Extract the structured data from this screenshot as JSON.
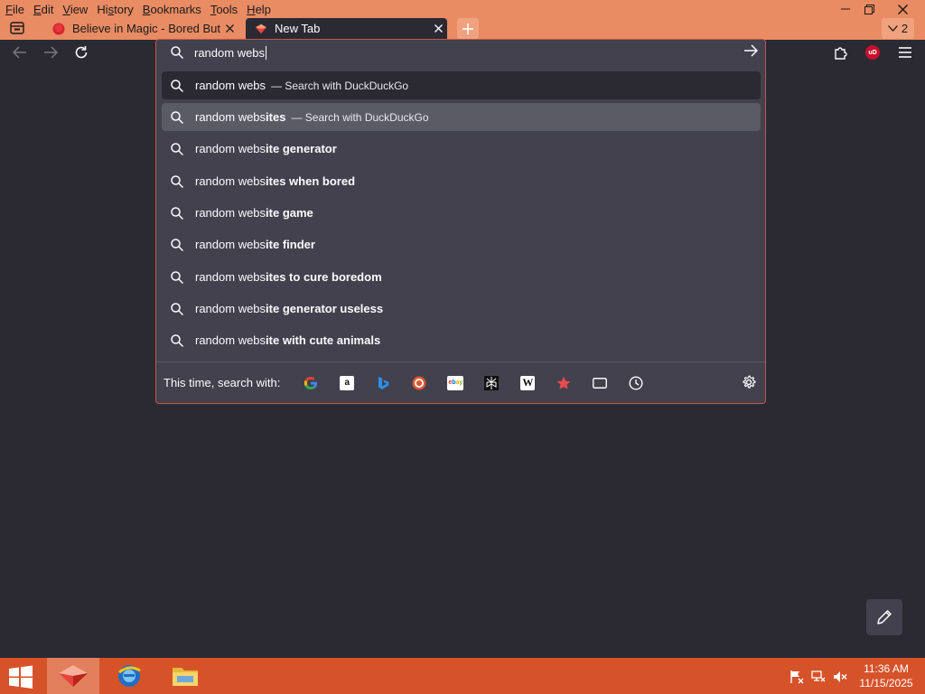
{
  "menu": {
    "items": [
      {
        "before": "",
        "key": "F",
        "after": "ile"
      },
      {
        "before": "",
        "key": "E",
        "after": "dit"
      },
      {
        "before": "",
        "key": "V",
        "after": "iew"
      },
      {
        "before": "Hi",
        "key": "s",
        "after": "tory"
      },
      {
        "before": "",
        "key": "B",
        "after": "ookmarks"
      },
      {
        "before": "",
        "key": "T",
        "after": "ools"
      },
      {
        "before": "",
        "key": "H",
        "after": "elp"
      }
    ]
  },
  "tabs": {
    "inactive_title": "Believe in Magic - Bored Button",
    "active_title": "New Tab",
    "all_tabs_count": "2"
  },
  "urlbar": {
    "value": "random webs"
  },
  "suggestions": [
    {
      "typed": "random webs",
      "bold": "",
      "action": "— Search with DuckDuckGo"
    },
    {
      "typed": "random webs",
      "bold": "ites",
      "action": "— Search with DuckDuckGo"
    },
    {
      "typed": "random webs",
      "bold": "ite generator",
      "action": ""
    },
    {
      "typed": "random webs",
      "bold": "ites when bored",
      "action": ""
    },
    {
      "typed": "random webs",
      "bold": "ite game",
      "action": ""
    },
    {
      "typed": "random webs",
      "bold": "ite finder",
      "action": ""
    },
    {
      "typed": "random webs",
      "bold": "ites to cure boredom",
      "action": ""
    },
    {
      "typed": "random webs",
      "bold": "ite generator useless",
      "action": ""
    },
    {
      "typed": "random webs",
      "bold": "ite with cute animals",
      "action": ""
    }
  ],
  "oneoff": {
    "label": "This time, search with:",
    "engines": [
      "google-icon",
      "amazon-icon",
      "bing-icon",
      "duckduckgo-icon",
      "ebay-icon",
      "perplexity-icon",
      "wikipedia-icon",
      "bookmarks-star-icon",
      "tabs-icon",
      "history-icon"
    ]
  },
  "taskbar": {
    "time": "11:36 AM",
    "date": "11/15/2025"
  },
  "colors": {
    "titlebar": "#e98b63",
    "taskbar": "#d6532a",
    "panel": "#42414d",
    "page": "#2b2a33"
  }
}
